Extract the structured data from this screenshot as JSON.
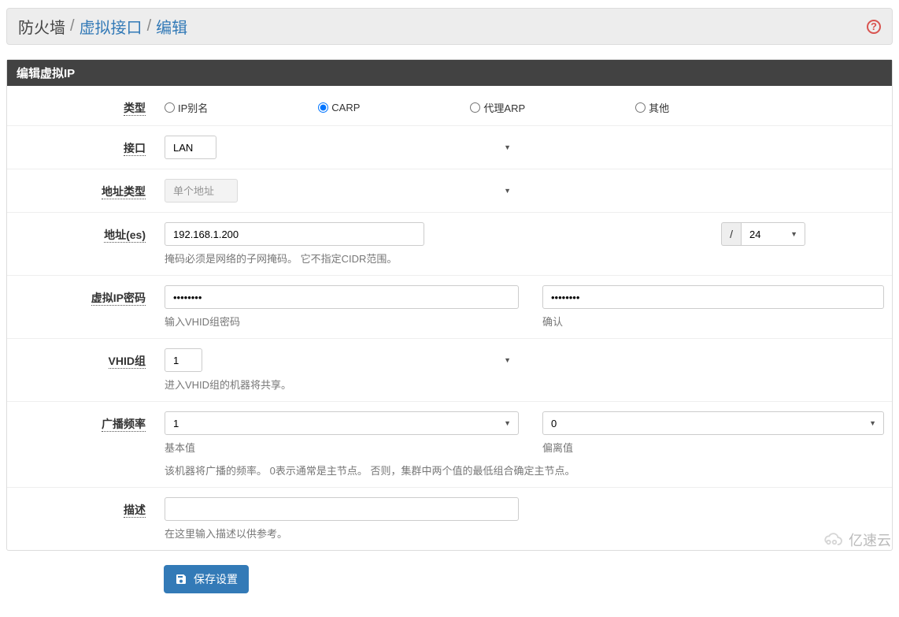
{
  "breadcrumb": {
    "first": "防火墙",
    "second": "虚拟接口",
    "third": "编辑"
  },
  "panel_title": "编辑虚拟IP",
  "fields": {
    "type": {
      "label": "类型",
      "options": {
        "ipalias": "IP别名",
        "carp": "CARP",
        "proxyarp": "代理ARP",
        "other": "其他"
      },
      "selected": "carp"
    },
    "interface": {
      "label": "接口",
      "value": "LAN"
    },
    "addr_type": {
      "label": "地址类型",
      "value": "单个地址"
    },
    "address": {
      "label": "地址(es)",
      "value": "192.168.1.200",
      "cidr_sep": "/",
      "cidr": "24",
      "help": "掩码必须是网络的子网掩码。 它不指定CIDR范围。"
    },
    "password": {
      "label": "虚拟IP密码",
      "value": "••••••••",
      "confirm_value": "••••••••",
      "help1": "输入VHID组密码",
      "help2": "确认"
    },
    "vhid": {
      "label": "VHID组",
      "value": "1",
      "help": "进入VHID组的机器将共享。"
    },
    "adv": {
      "label": "广播频率",
      "base": "1",
      "skew": "0",
      "help_base": "基本值",
      "help_skew": "偏离值",
      "help_desc": "该机器将广播的频率。 0表示通常是主节点。 否则，集群中两个值的最低组合确定主节点。"
    },
    "descr": {
      "label": "描述",
      "value": "",
      "help": "在这里输入描述以供参考。"
    }
  },
  "save_label": "保存设置",
  "watermark": "亿速云"
}
